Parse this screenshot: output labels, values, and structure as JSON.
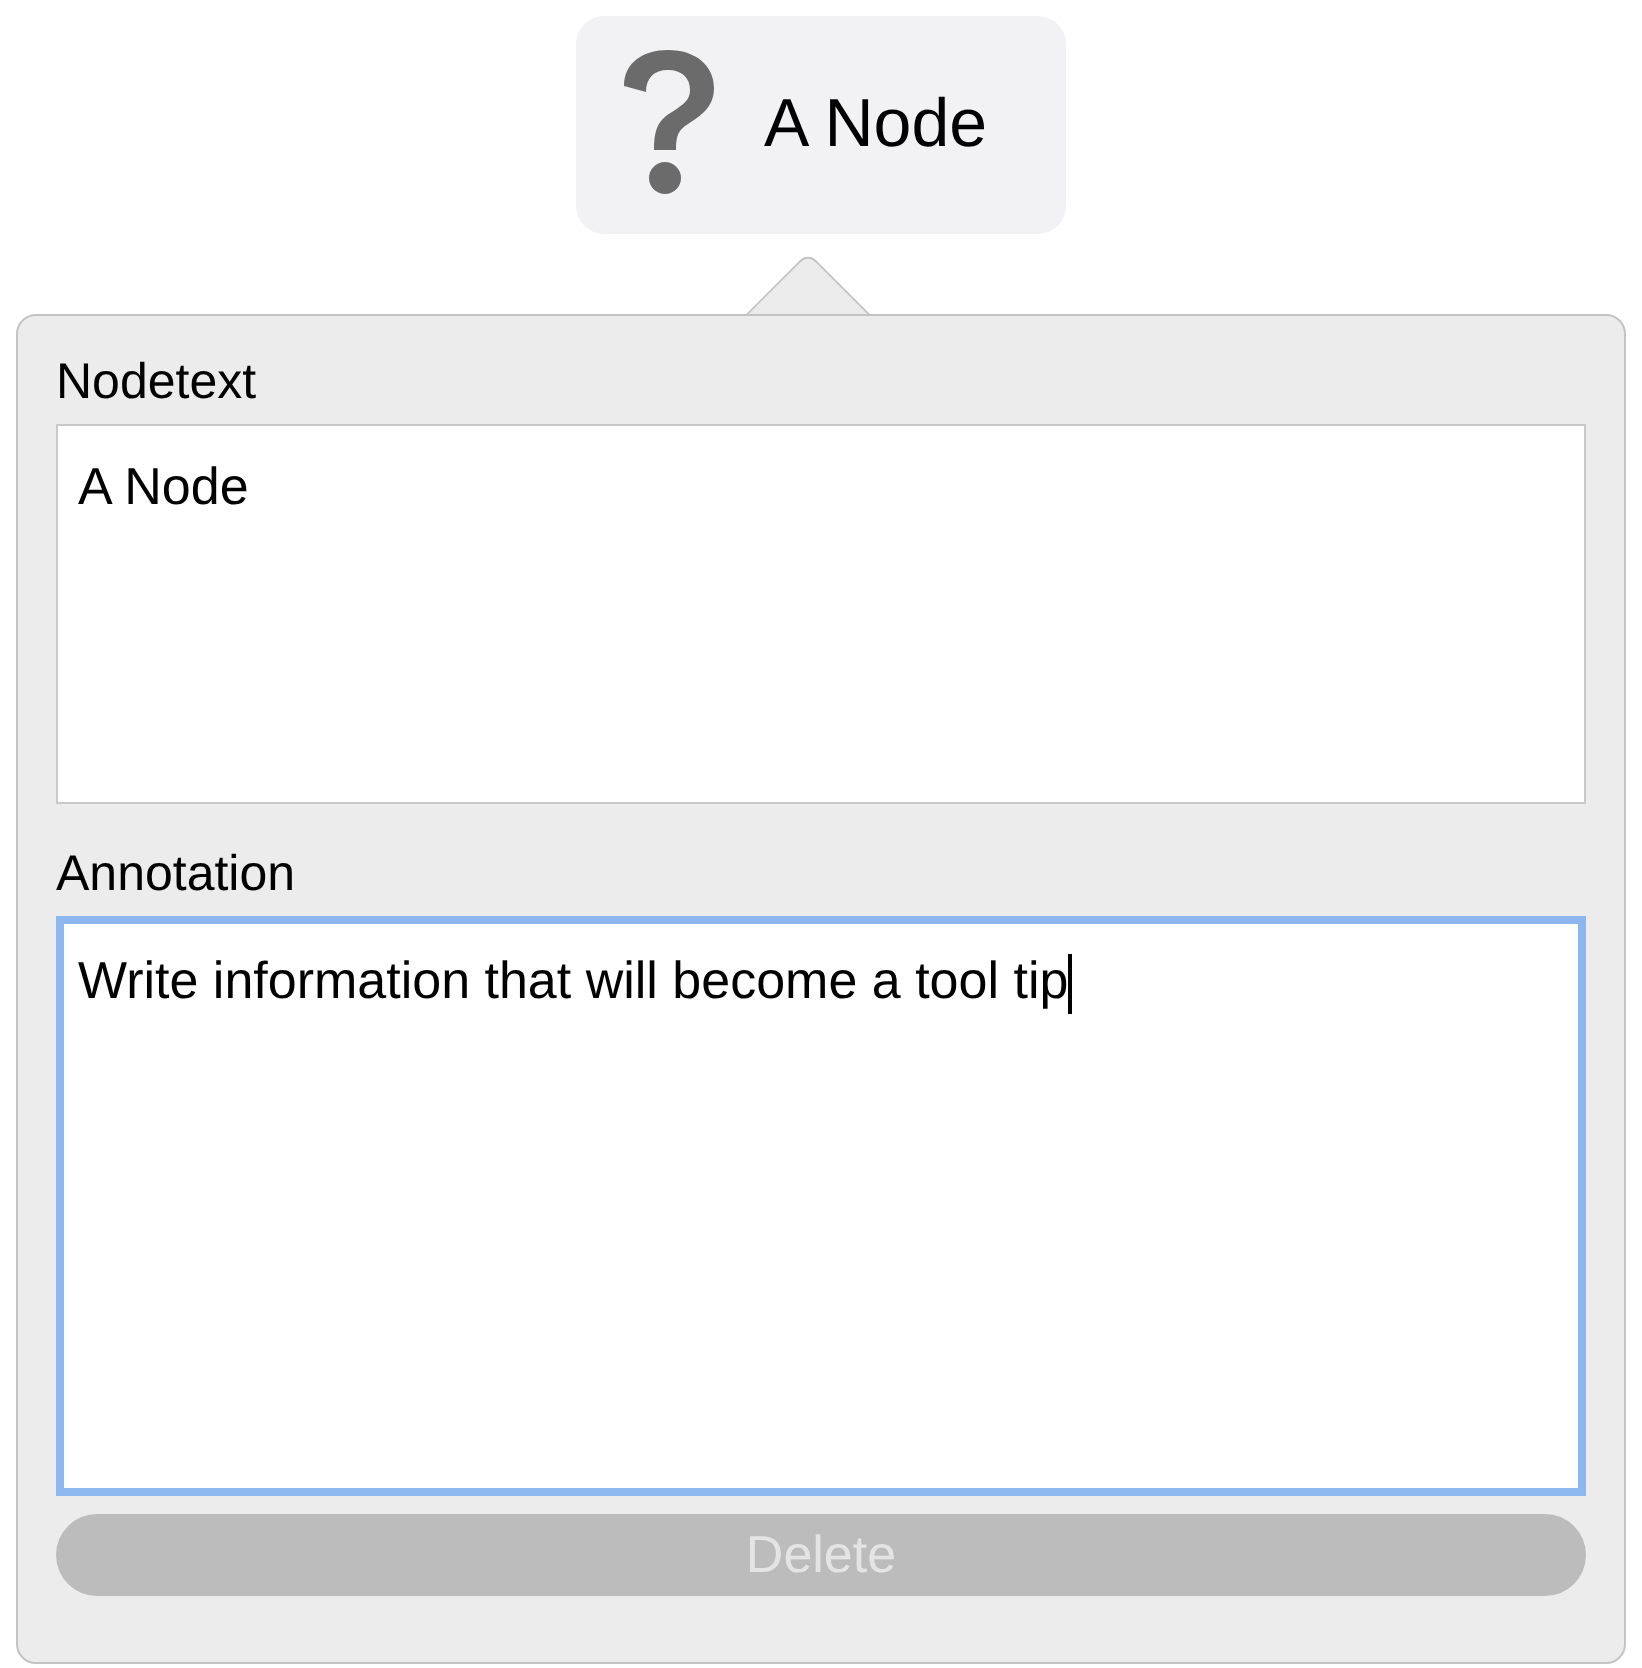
{
  "node": {
    "label": "A Node"
  },
  "popover": {
    "fields": [
      {
        "label": "Nodetext",
        "value": "A Node",
        "focused": false
      },
      {
        "label": "Annotation",
        "value": "Write information that will become a tool tip",
        "focused": true
      }
    ],
    "delete_button": {
      "label": "Delete",
      "disabled": true
    }
  }
}
